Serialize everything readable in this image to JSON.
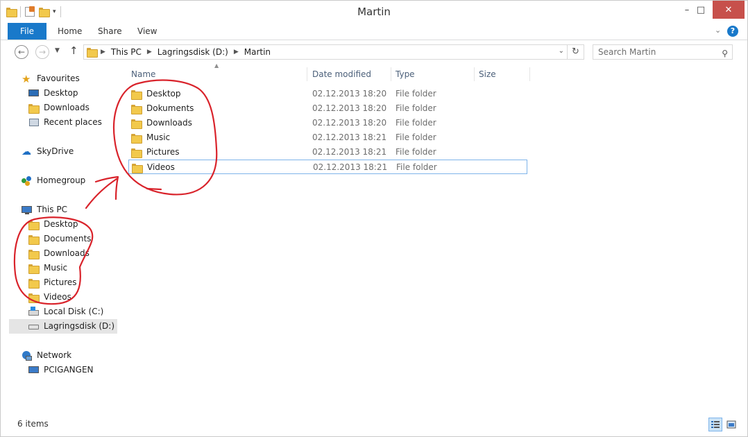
{
  "window": {
    "title": "Martin",
    "controls": {
      "minimize": "–",
      "maximize": "□",
      "close": "✕"
    }
  },
  "ribbon": {
    "tabs": [
      "File",
      "Home",
      "Share",
      "View"
    ],
    "collapse_glyph": "⌄",
    "help_glyph": "?"
  },
  "address": {
    "breadcrumb": [
      "This PC",
      "Lagringsdisk (D:)",
      "Martin"
    ],
    "search_placeholder": "Search Martin"
  },
  "nav_pane": {
    "favourites": {
      "label": "Favourites",
      "items": [
        "Desktop",
        "Downloads",
        "Recent places"
      ]
    },
    "skydrive": "SkyDrive",
    "homegroup": "Homegroup",
    "this_pc": {
      "label": "This PC",
      "items": [
        "Desktop",
        "Documents",
        "Downloads",
        "Music",
        "Pictures",
        "Videos",
        "Local Disk (C:)",
        "Lagringsdisk (D:)"
      ],
      "selected": "Lagringsdisk (D:)"
    },
    "network": {
      "label": "Network",
      "items": [
        "PCIGANGEN"
      ]
    }
  },
  "file_list": {
    "columns": [
      "Name",
      "Date modified",
      "Type",
      "Size"
    ],
    "rows": [
      {
        "name": "Desktop",
        "date": "02.12.2013 18:20",
        "type": "File folder",
        "size": ""
      },
      {
        "name": "Dokuments",
        "date": "02.12.2013 18:20",
        "type": "File folder",
        "size": ""
      },
      {
        "name": "Downloads",
        "date": "02.12.2013 18:20",
        "type": "File folder",
        "size": ""
      },
      {
        "name": "Music",
        "date": "02.12.2013 18:21",
        "type": "File folder",
        "size": ""
      },
      {
        "name": "Pictures",
        "date": "02.12.2013 18:21",
        "type": "File folder",
        "size": ""
      },
      {
        "name": "Videos",
        "date": "02.12.2013 18:21",
        "type": "File folder",
        "size": ""
      }
    ],
    "focused_row": "Videos"
  },
  "status": {
    "item_count": "6 items"
  },
  "colors": {
    "accent": "#1979ca",
    "close": "#c7504b",
    "annotation": "#d9232b",
    "folder": "#f2c94c"
  }
}
